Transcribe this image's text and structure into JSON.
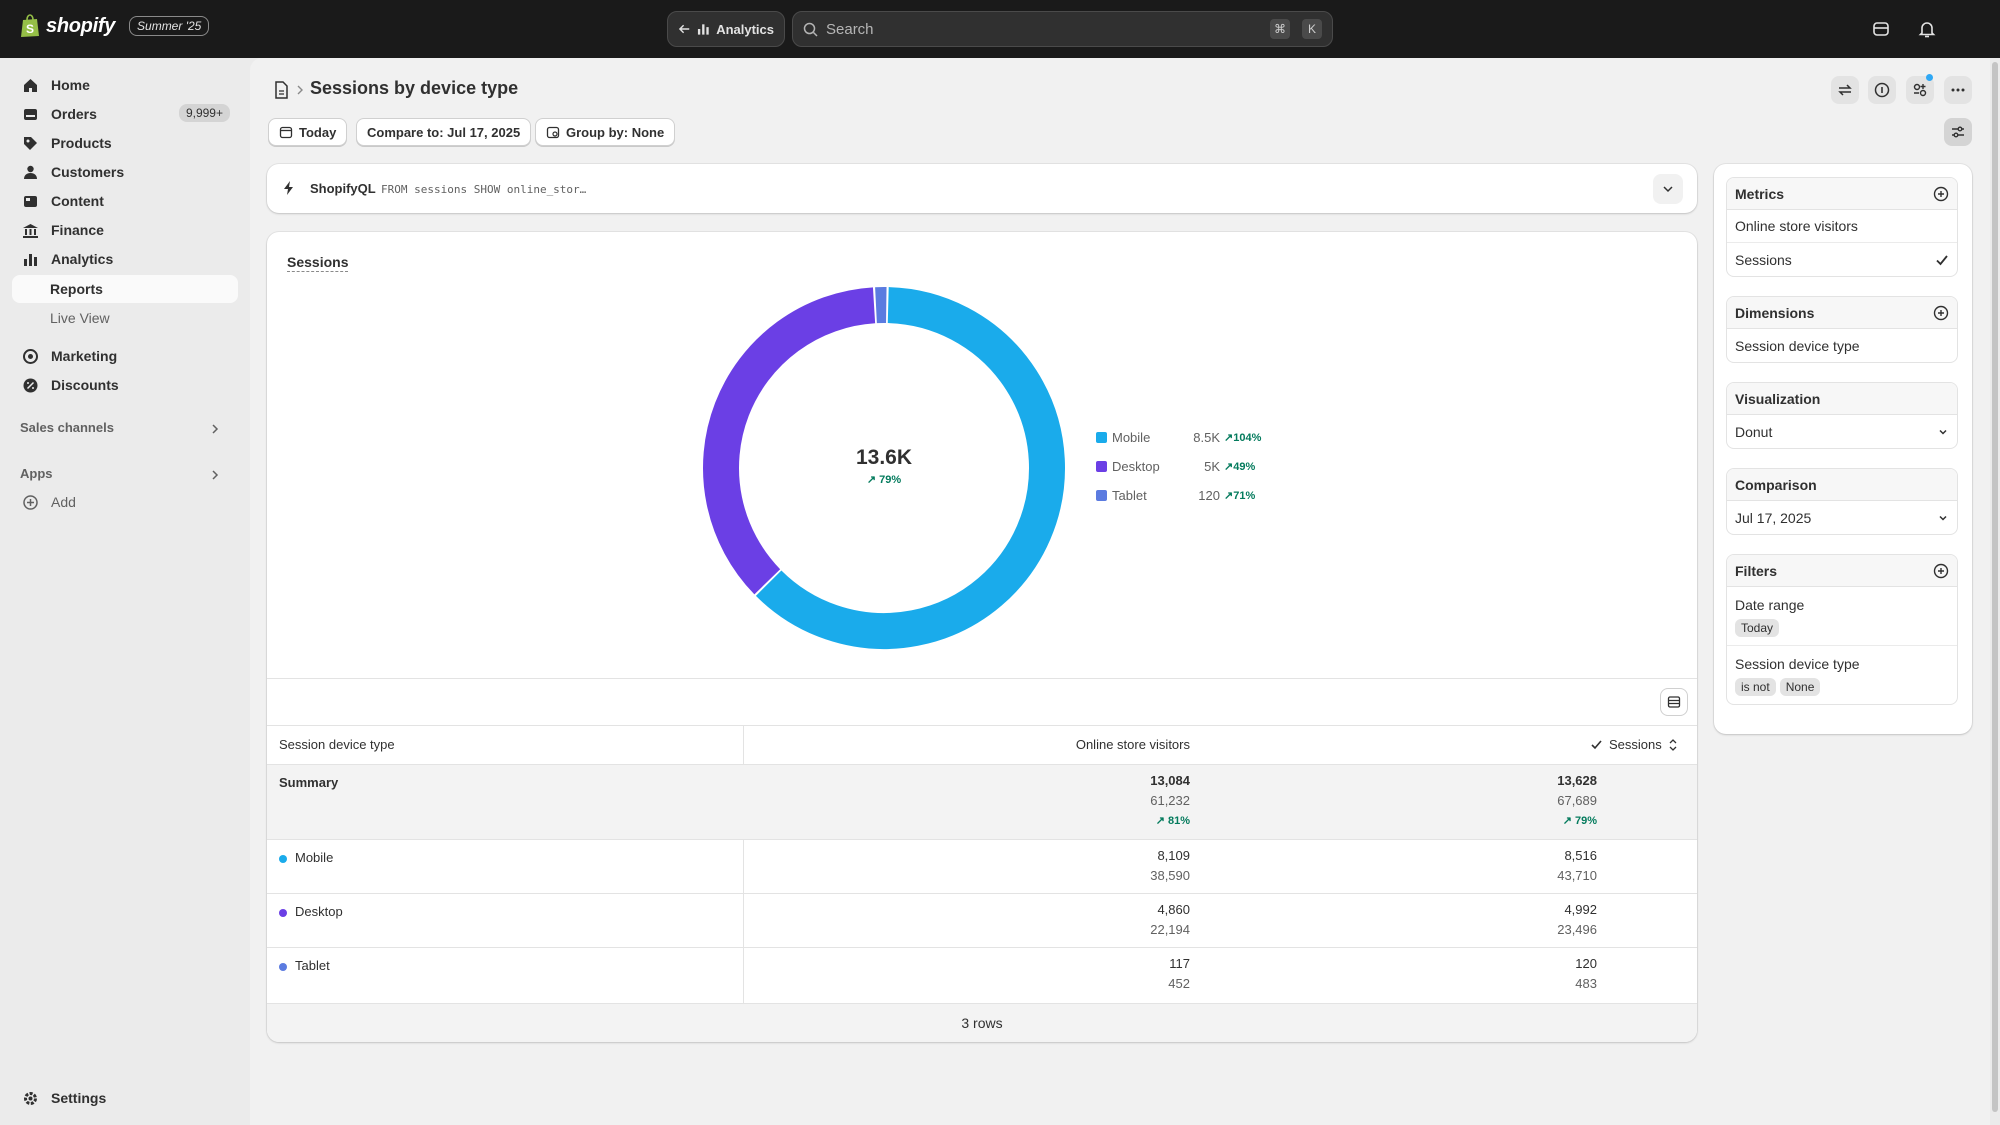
{
  "topbar": {
    "brand": "shopify",
    "edition": "Summer '25",
    "app_label": "Analytics",
    "search_placeholder": "Search",
    "shortcut_keys": [
      "⌘",
      "K"
    ]
  },
  "sidebar": {
    "items": [
      {
        "label": "Home",
        "icon": "home-icon"
      },
      {
        "label": "Orders",
        "icon": "orders-icon",
        "badge": "9,999+"
      },
      {
        "label": "Products",
        "icon": "tag-icon"
      },
      {
        "label": "Customers",
        "icon": "person-icon"
      },
      {
        "label": "Content",
        "icon": "content-icon"
      },
      {
        "label": "Finance",
        "icon": "bank-icon"
      },
      {
        "label": "Analytics",
        "icon": "chart-icon"
      },
      {
        "label": "Reports"
      },
      {
        "label": "Live View"
      },
      {
        "label": "Marketing",
        "icon": "target-icon"
      },
      {
        "label": "Discounts",
        "icon": "discount-icon"
      }
    ],
    "sales_channels": "Sales channels",
    "apps": "Apps",
    "add": "Add",
    "settings": "Settings"
  },
  "page": {
    "title": "Sessions by device type",
    "date_button": "Today",
    "compare_button": "Compare to: Jul 17, 2025",
    "group_button": "Group by: None"
  },
  "query": {
    "label": "ShopifyQL",
    "text": "FROM sessions SHOW online_stor…"
  },
  "chart_data": {
    "type": "pie",
    "title": "Sessions",
    "center_value": "13.6K",
    "center_change": "79%",
    "categories": [
      "Mobile",
      "Desktop",
      "Tablet"
    ],
    "values": [
      8516,
      4992,
      120
    ],
    "display_values": [
      "8.5K",
      "5K",
      "120"
    ],
    "changes": [
      "104%",
      "49%",
      "71%"
    ],
    "colors": [
      "#1aabeb",
      "#6b3fe5",
      "#5b7be0"
    ],
    "legend_position": "right"
  },
  "table": {
    "headers": [
      "Session device type",
      "Online store visitors",
      "Sessions"
    ],
    "summary": {
      "label": "Summary",
      "visitors": "13,084",
      "visitors_prev": "61,232",
      "visitors_change": "81%",
      "sessions": "13,628",
      "sessions_prev": "67,689",
      "sessions_change": "79%"
    },
    "rows": [
      {
        "label": "Mobile",
        "visitors": "8,109",
        "visitors_prev": "38,590",
        "sessions": "8,516",
        "sessions_prev": "43,710",
        "color": "#1aabeb"
      },
      {
        "label": "Desktop",
        "visitors": "4,860",
        "visitors_prev": "22,194",
        "sessions": "4,992",
        "sessions_prev": "23,496",
        "color": "#6b3fe5"
      },
      {
        "label": "Tablet",
        "visitors": "117",
        "visitors_prev": "452",
        "sessions": "120",
        "sessions_prev": "483",
        "color": "#5b7be0"
      }
    ],
    "footer": "3 rows"
  },
  "panel": {
    "metrics": {
      "title": "Metrics",
      "items": [
        "Online store visitors",
        "Sessions"
      ]
    },
    "dimensions": {
      "title": "Dimensions",
      "items": [
        "Session device type"
      ]
    },
    "visualization": {
      "title": "Visualization",
      "value": "Donut"
    },
    "comparison": {
      "title": "Comparison",
      "value": "Jul 17, 2025"
    },
    "filters": {
      "title": "Filters",
      "date_range": "Date range",
      "date_value": "Today",
      "device_label": "Session device type",
      "operator": "is not",
      "value": "None"
    }
  }
}
